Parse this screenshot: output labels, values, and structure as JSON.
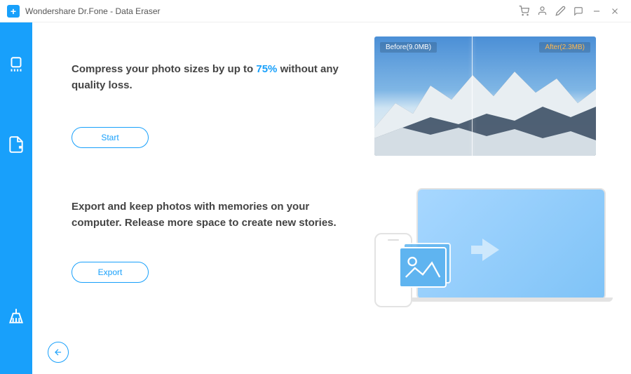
{
  "titlebar": {
    "title": "Wondershare Dr.Fone - Data Eraser",
    "logo_glyph": "+"
  },
  "sidebar": {
    "items": [
      {
        "name": "eraser"
      },
      {
        "name": "document"
      },
      {
        "name": "broom"
      }
    ]
  },
  "compress": {
    "heading_pre": "Compress your photo sizes by up to ",
    "heading_highlight": "75%",
    "heading_post": " without any quality loss.",
    "button": "Start",
    "before_label": "Before(9.0MB)",
    "after_label": "After(2.3MB)"
  },
  "export": {
    "heading": "Export and keep photos with memories on your computer. Release more space to create new stories.",
    "button": "Export"
  }
}
